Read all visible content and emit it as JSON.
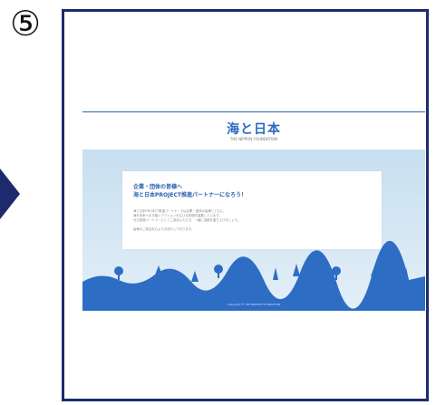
{
  "step": {
    "number": "⑤"
  },
  "colors": {
    "frame": "#1d2b6e",
    "brand": "#2a68c2",
    "sea": "#2d6dc4"
  },
  "site": {
    "logo": "海と日本",
    "logo_sub": "THE NIPPON FOUNDATION",
    "card": {
      "title_line1": "企業・団体の皆様へ",
      "title_line2": "海と日本PROJECT推進パートナーになろう！",
      "body_lines": [
        "海と日本PROJECT推進パートナーでは企業・団体の皆様とともに、",
        "海を未来へ引き継ぐアクションを広げる仲間を募集しています。",
        "ぜひ推進パートナーとしてご参加いただき、一緒に活動を盛り上げましょう。",
        "",
        "皆様のご参加を心よりお待ちしております。"
      ]
    },
    "footer": "Copyright © THE NIPPON FOUNDATION"
  }
}
